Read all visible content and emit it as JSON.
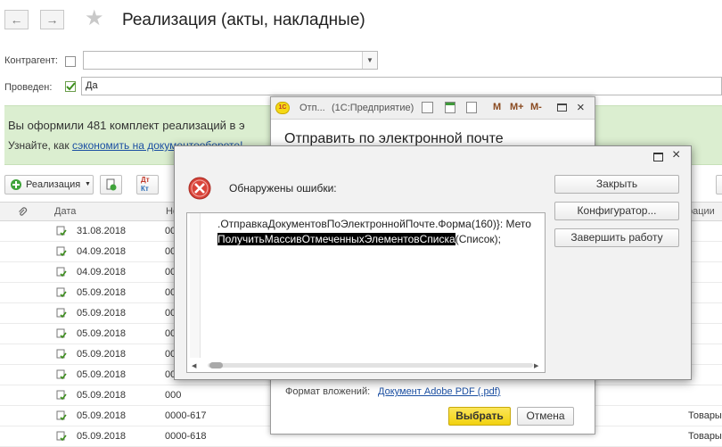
{
  "window": {
    "title": "Реализация (акты, накладные)"
  },
  "filters": {
    "counterparty_label": "Контрагент:",
    "counterparty_value": "",
    "posted_label": "Проведен:",
    "posted_value": "Да"
  },
  "banner": {
    "line1": "Вы оформили 481 комплект реализаций в э",
    "line2_prefix": "Узнайте, как ",
    "line2_link": "сэкономить на документообороте!"
  },
  "toolbar": {
    "realization_label": "Реализация"
  },
  "table": {
    "headers": {
      "date": "Дата",
      "number": "Но",
      "operation": "рации"
    },
    "rows": [
      {
        "date": "31.08.2018",
        "number": "000",
        "type": ""
      },
      {
        "date": "04.09.2018",
        "number": "000",
        "type": ""
      },
      {
        "date": "04.09.2018",
        "number": "000",
        "type": ""
      },
      {
        "date": "05.09.2018",
        "number": "000",
        "type": ""
      },
      {
        "date": "05.09.2018",
        "number": "000",
        "type": ""
      },
      {
        "date": "05.09.2018",
        "number": "000",
        "type": ""
      },
      {
        "date": "05.09.2018",
        "number": "000",
        "type": ""
      },
      {
        "date": "05.09.2018",
        "number": "000",
        "type": ""
      },
      {
        "date": "05.09.2018",
        "number": "000",
        "type": ""
      },
      {
        "date": "05.09.2018",
        "number": "0000-617",
        "type": "Товары"
      },
      {
        "date": "05.09.2018",
        "number": "0000-618",
        "type": "Товары"
      }
    ]
  },
  "email_window": {
    "title_short": "Отп...",
    "title_app": "(1С:Предприятие)",
    "heading": "Отправить по электронной почте",
    "format_label": "Формат вложений:",
    "format_link": "Документ Adobe PDF (.pdf)",
    "select_button": "Выбрать",
    "cancel_button": "Отмена",
    "tool_m": "M",
    "tool_mplus": "M+",
    "tool_mminus": "M-",
    "logo_text": "1С"
  },
  "error_dialog": {
    "title": "Обнаружены ошибки:",
    "error_line1": ".ОтправкаДокументовПоЭлектроннойПочте.Форма(160)}: Мето",
    "error_highlight": "ПолучитьМассивОтмеченныхЭлементовСписка",
    "error_rest": "(Список);",
    "buttons": {
      "close": "Закрыть",
      "configurator": "Конфигуратор...",
      "exit": "Завершить работу"
    }
  },
  "colors": {
    "banner_bg": "#dbeed0",
    "link": "#1b4fa2",
    "select_button": "#f5d915",
    "error_icon": "#d9443a"
  }
}
